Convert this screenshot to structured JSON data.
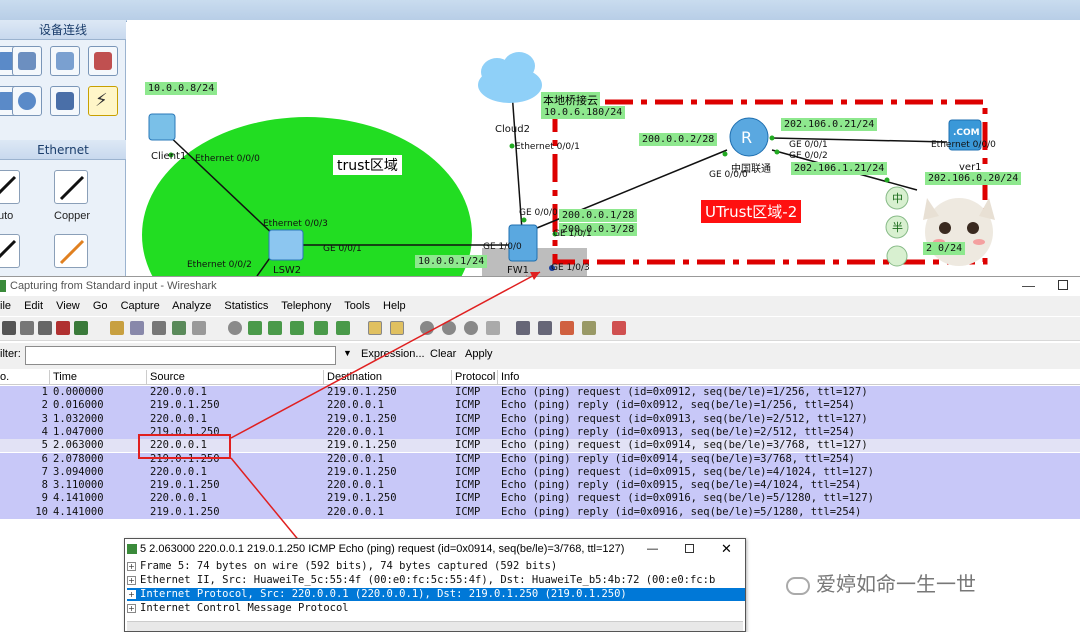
{
  "ensp": {
    "panel_title_devices": "设备连线",
    "panel_title_ethernet": "Ethernet",
    "cable_auto": "uto",
    "cable_copper": "Copper",
    "canvas": {
      "zone_trust": "trust区域",
      "zone_untrust": "UTrust区域-2",
      "cloud_label": "本地桥接云",
      "ips": {
        "client_ip": "10.0.0.8/24",
        "cloud_ip": "10.0.6.180/24",
        "r_left_ip": "200.0.0.2/28",
        "r_top_ip": "202.106.0.21/24",
        "r_bottom_ip": "202.106.1.21/24",
        "server_ip": "202.106.0.20/24",
        "fw_ip1": "200.0.0.1/28",
        "fw_ip2": "200.0.0.3/28",
        "fw_ip3": "10.0.0.1/24",
        "bottom_right_ip": "2 0/24"
      },
      "devices": {
        "client": "Client1",
        "cloud": "Cloud2",
        "router": "中国联通",
        "lsw": "LSW2",
        "fw": "FW1",
        "server": "ver1"
      },
      "ports": {
        "client_eth": "Ethernet 0/0/0",
        "lsw_eth3": "Ethernet 0/0/3",
        "lsw_eth2": "Ethernet 0/0/2",
        "lsw_ge": "GE 0/0/1",
        "cloud_eth": "Ethernet 0/0/1",
        "fw_ge000": "GE 0/0/0",
        "fw_ge10": "GE 1/0/0",
        "fw_ge11": "GE 1/0/1",
        "fw_ge13": "GE 1/0/3",
        "r_ge000": "GE 0/0/0",
        "r_ge001": "GE 0/0/1",
        "r_ge002": "GE 0/0/2",
        "server_eth": "Ethernet 0/0/0",
        "com": ".COM"
      },
      "sticker": [
        "中",
        "半"
      ]
    }
  },
  "wireshark": {
    "title": "Capturing from Standard input - Wireshark",
    "menu": [
      "ile",
      "Edit",
      "View",
      "Go",
      "Capture",
      "Analyze",
      "Statistics",
      "Telephony",
      "Tools",
      "Help"
    ],
    "filter_label": "ilter:",
    "filter_value": "",
    "expression": "Expression...",
    "clear": "Clear",
    "apply": "Apply",
    "columns": [
      "o.",
      "Time",
      "Source",
      "Destination",
      "Protocol",
      "Info"
    ],
    "packets": [
      {
        "no": "1",
        "time": "0.000000",
        "src": "220.0.0.1",
        "dst": "219.0.1.250",
        "proto": "ICMP",
        "info": "Echo (ping) request  (id=0x0912, seq(be/le)=1/256, ttl=127)"
      },
      {
        "no": "2",
        "time": "0.016000",
        "src": "219.0.1.250",
        "dst": "220.0.0.1",
        "proto": "ICMP",
        "info": "Echo (ping) reply    (id=0x0912, seq(be/le)=1/256, ttl=254)"
      },
      {
        "no": "3",
        "time": "1.032000",
        "src": "220.0.0.1",
        "dst": "219.0.1.250",
        "proto": "ICMP",
        "info": "Echo (ping) request  (id=0x0913, seq(be/le)=2/512, ttl=127)"
      },
      {
        "no": "4",
        "time": "1.047000",
        "src": "219.0.1.250",
        "dst": "220.0.0.1",
        "proto": "ICMP",
        "info": "Echo (ping) reply    (id=0x0913, seq(be/le)=2/512, ttl=254)"
      },
      {
        "no": "5",
        "time": "2.063000",
        "src": "220.0.0.1",
        "dst": "219.0.1.250",
        "proto": "ICMP",
        "info": "Echo (ping) request  (id=0x0914, seq(be/le)=3/768, ttl=127)"
      },
      {
        "no": "6",
        "time": "2.078000",
        "src": "219.0.1.250",
        "dst": "220.0.0.1",
        "proto": "ICMP",
        "info": "Echo (ping) reply    (id=0x0914, seq(be/le)=3/768, ttl=254)"
      },
      {
        "no": "7",
        "time": "3.094000",
        "src": "220.0.0.1",
        "dst": "219.0.1.250",
        "proto": "ICMP",
        "info": "Echo (ping) request  (id=0x0915, seq(be/le)=4/1024, ttl=127)"
      },
      {
        "no": "8",
        "time": "3.110000",
        "src": "219.0.1.250",
        "dst": "220.0.0.1",
        "proto": "ICMP",
        "info": "Echo (ping) reply    (id=0x0915, seq(be/le)=4/1024, ttl=254)"
      },
      {
        "no": "9",
        "time": "4.141000",
        "src": "220.0.0.1",
        "dst": "219.0.1.250",
        "proto": "ICMP",
        "info": "Echo (ping) request  (id=0x0916, seq(be/le)=5/1280, ttl=127)"
      },
      {
        "no": "10",
        "time": "4.141000",
        "src": "219.0.1.250",
        "dst": "220.0.0.1",
        "proto": "ICMP",
        "info": "Echo (ping) reply    (id=0x0916, seq(be/le)=5/1280, ttl=254)"
      }
    ],
    "popup": {
      "title": "5 2.063000 220.0.0.1 219.0.1.250 ICMP Echo (ping) request  (id=0x0914, seq(be/le)=3/768, ttl=127)",
      "lines": [
        "Frame 5: 74 bytes on wire (592 bits), 74 bytes captured (592 bits)",
        "Ethernet II, Src: HuaweiTe_5c:55:4f (00:e0:fc:5c:55:4f), Dst: HuaweiTe_b5:4b:72 (00:e0:fc:b",
        "Internet Protocol, Src: 220.0.0.1 (220.0.0.1), Dst: 219.0.1.250 (219.0.1.250)",
        "Internet Control Message Protocol"
      ]
    }
  },
  "watermark": "爱婷如命一生一世",
  "colors": {
    "packet_bg": "#c8c8f8",
    "selected_popup": "#0078d7",
    "zone_green": "#22dd22",
    "untrust_red": "#dd0000",
    "ip_label_green": "#8ee88e"
  }
}
